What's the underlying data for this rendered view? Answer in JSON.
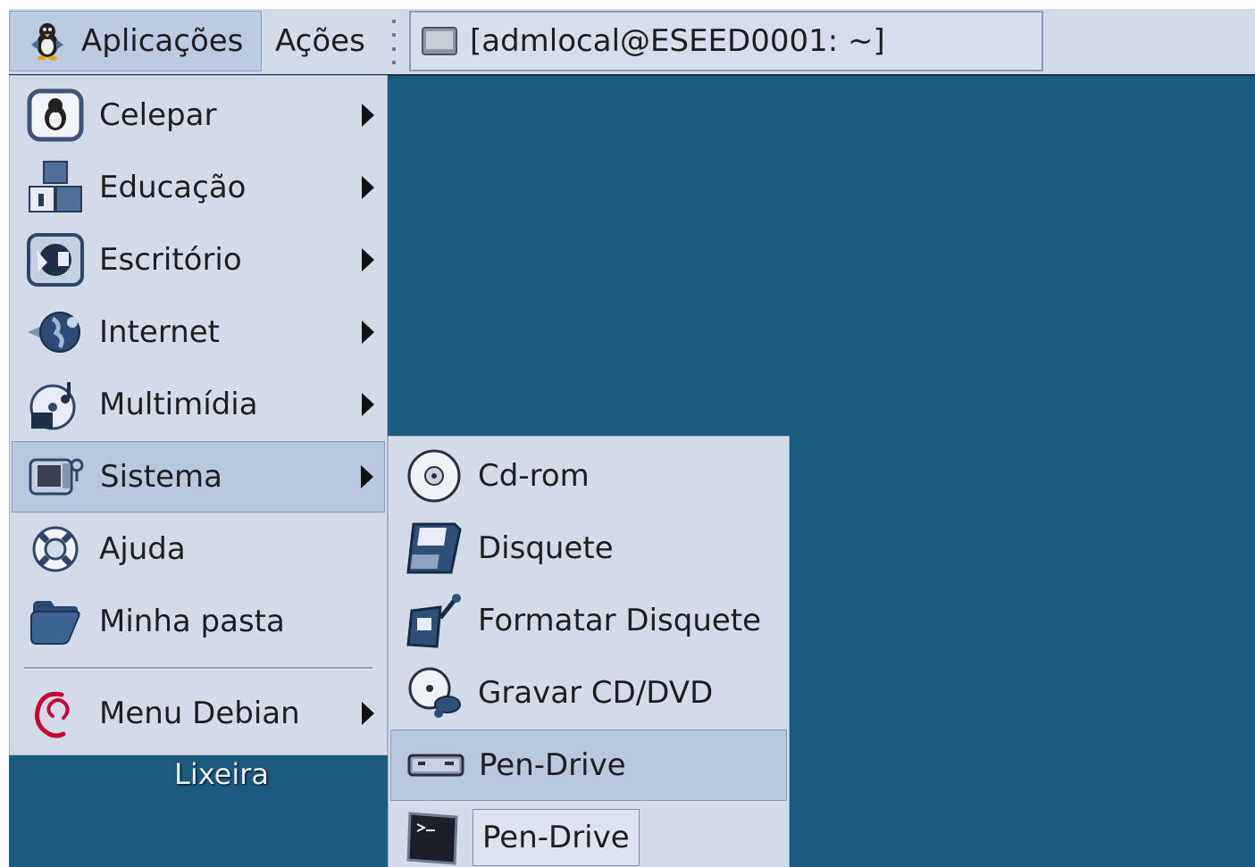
{
  "panel": {
    "apps_label": "Aplicações",
    "actions_label": "Ações",
    "task_title": "[admlocal@ESEED0001: ~]"
  },
  "main_menu": {
    "items": [
      {
        "label": "Celepar",
        "icon": "celepar-penguin-icon",
        "submenu": true
      },
      {
        "label": "Educação",
        "icon": "education-blocks-icon",
        "submenu": true
      },
      {
        "label": "Escritório",
        "icon": "office-icon",
        "submenu": true
      },
      {
        "label": "Internet",
        "icon": "globe-icon",
        "submenu": true
      },
      {
        "label": "Multimídia",
        "icon": "multimedia-disc-icon",
        "submenu": true
      },
      {
        "label": "Sistema",
        "icon": "system-computer-icon",
        "submenu": true,
        "selected": true
      },
      {
        "label": "Ajuda",
        "icon": "lifebuoy-help-icon",
        "submenu": false
      },
      {
        "label": "Minha pasta",
        "icon": "folder-icon",
        "submenu": false
      },
      {
        "label": "Menu Debian",
        "icon": "debian-swirl-icon",
        "submenu": true
      }
    ]
  },
  "system_submenu": {
    "items": [
      {
        "label": "Cd-rom",
        "icon": "cdrom-icon"
      },
      {
        "label": "Disquete",
        "icon": "floppy-icon"
      },
      {
        "label": "Formatar Disquete",
        "icon": "format-floppy-icon"
      },
      {
        "label": "Gravar CD/DVD",
        "icon": "burn-cd-icon"
      },
      {
        "label": "Pen-Drive",
        "icon": "pen-drive-icon",
        "selected": true
      },
      {
        "label": "",
        "icon": "terminal-icon"
      }
    ],
    "tooltip": "Pen-Drive"
  },
  "desktop": {
    "trash_label": "Lixeira"
  },
  "colors": {
    "desktop": "#1b5a80",
    "menu_bg": "#d3dbe9",
    "selection": "#b9c8dc"
  }
}
